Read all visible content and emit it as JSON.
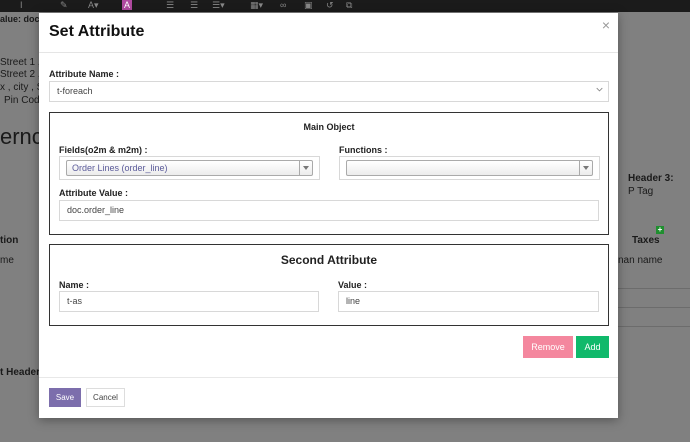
{
  "background": {
    "toolbar_value_label": "alue: doc",
    "left_lines": [
      "Street 1 ,",
      "Street 2 ,",
      "x , city , St",
      "Pin Code"
    ],
    "heading": "ernce",
    "header3_label": "Header 3:",
    "header3_value": "P Tag",
    "col_left": "tion",
    "col_taxes": "Taxes",
    "row_left": "me",
    "row_right": "nan name",
    "bottom_label": "t Header:"
  },
  "modal": {
    "title": "Set Attribute",
    "close_glyph": "×",
    "attribute_name": {
      "label": "Attribute Name :",
      "value": "t-foreach"
    },
    "main_object": {
      "title": "Main Object",
      "fields_label": "Fields(o2m & m2m) :",
      "fields_value": "Order Lines (order_line)",
      "functions_label": "Functions :",
      "functions_value": "",
      "attribute_value_label": "Attribute Value :",
      "attribute_value": "doc.order_line"
    },
    "second_attribute": {
      "title": "Second Attribute",
      "name_label": "Name :",
      "name_value": "t-as",
      "value_label": "Value :",
      "value_value": "line"
    },
    "buttons": {
      "remove": "Remove",
      "add": "Add",
      "save": "Save",
      "cancel": "Cancel"
    }
  },
  "colors": {
    "remove": "#f4879e",
    "add": "#10b96b",
    "save": "#7c6eac"
  }
}
